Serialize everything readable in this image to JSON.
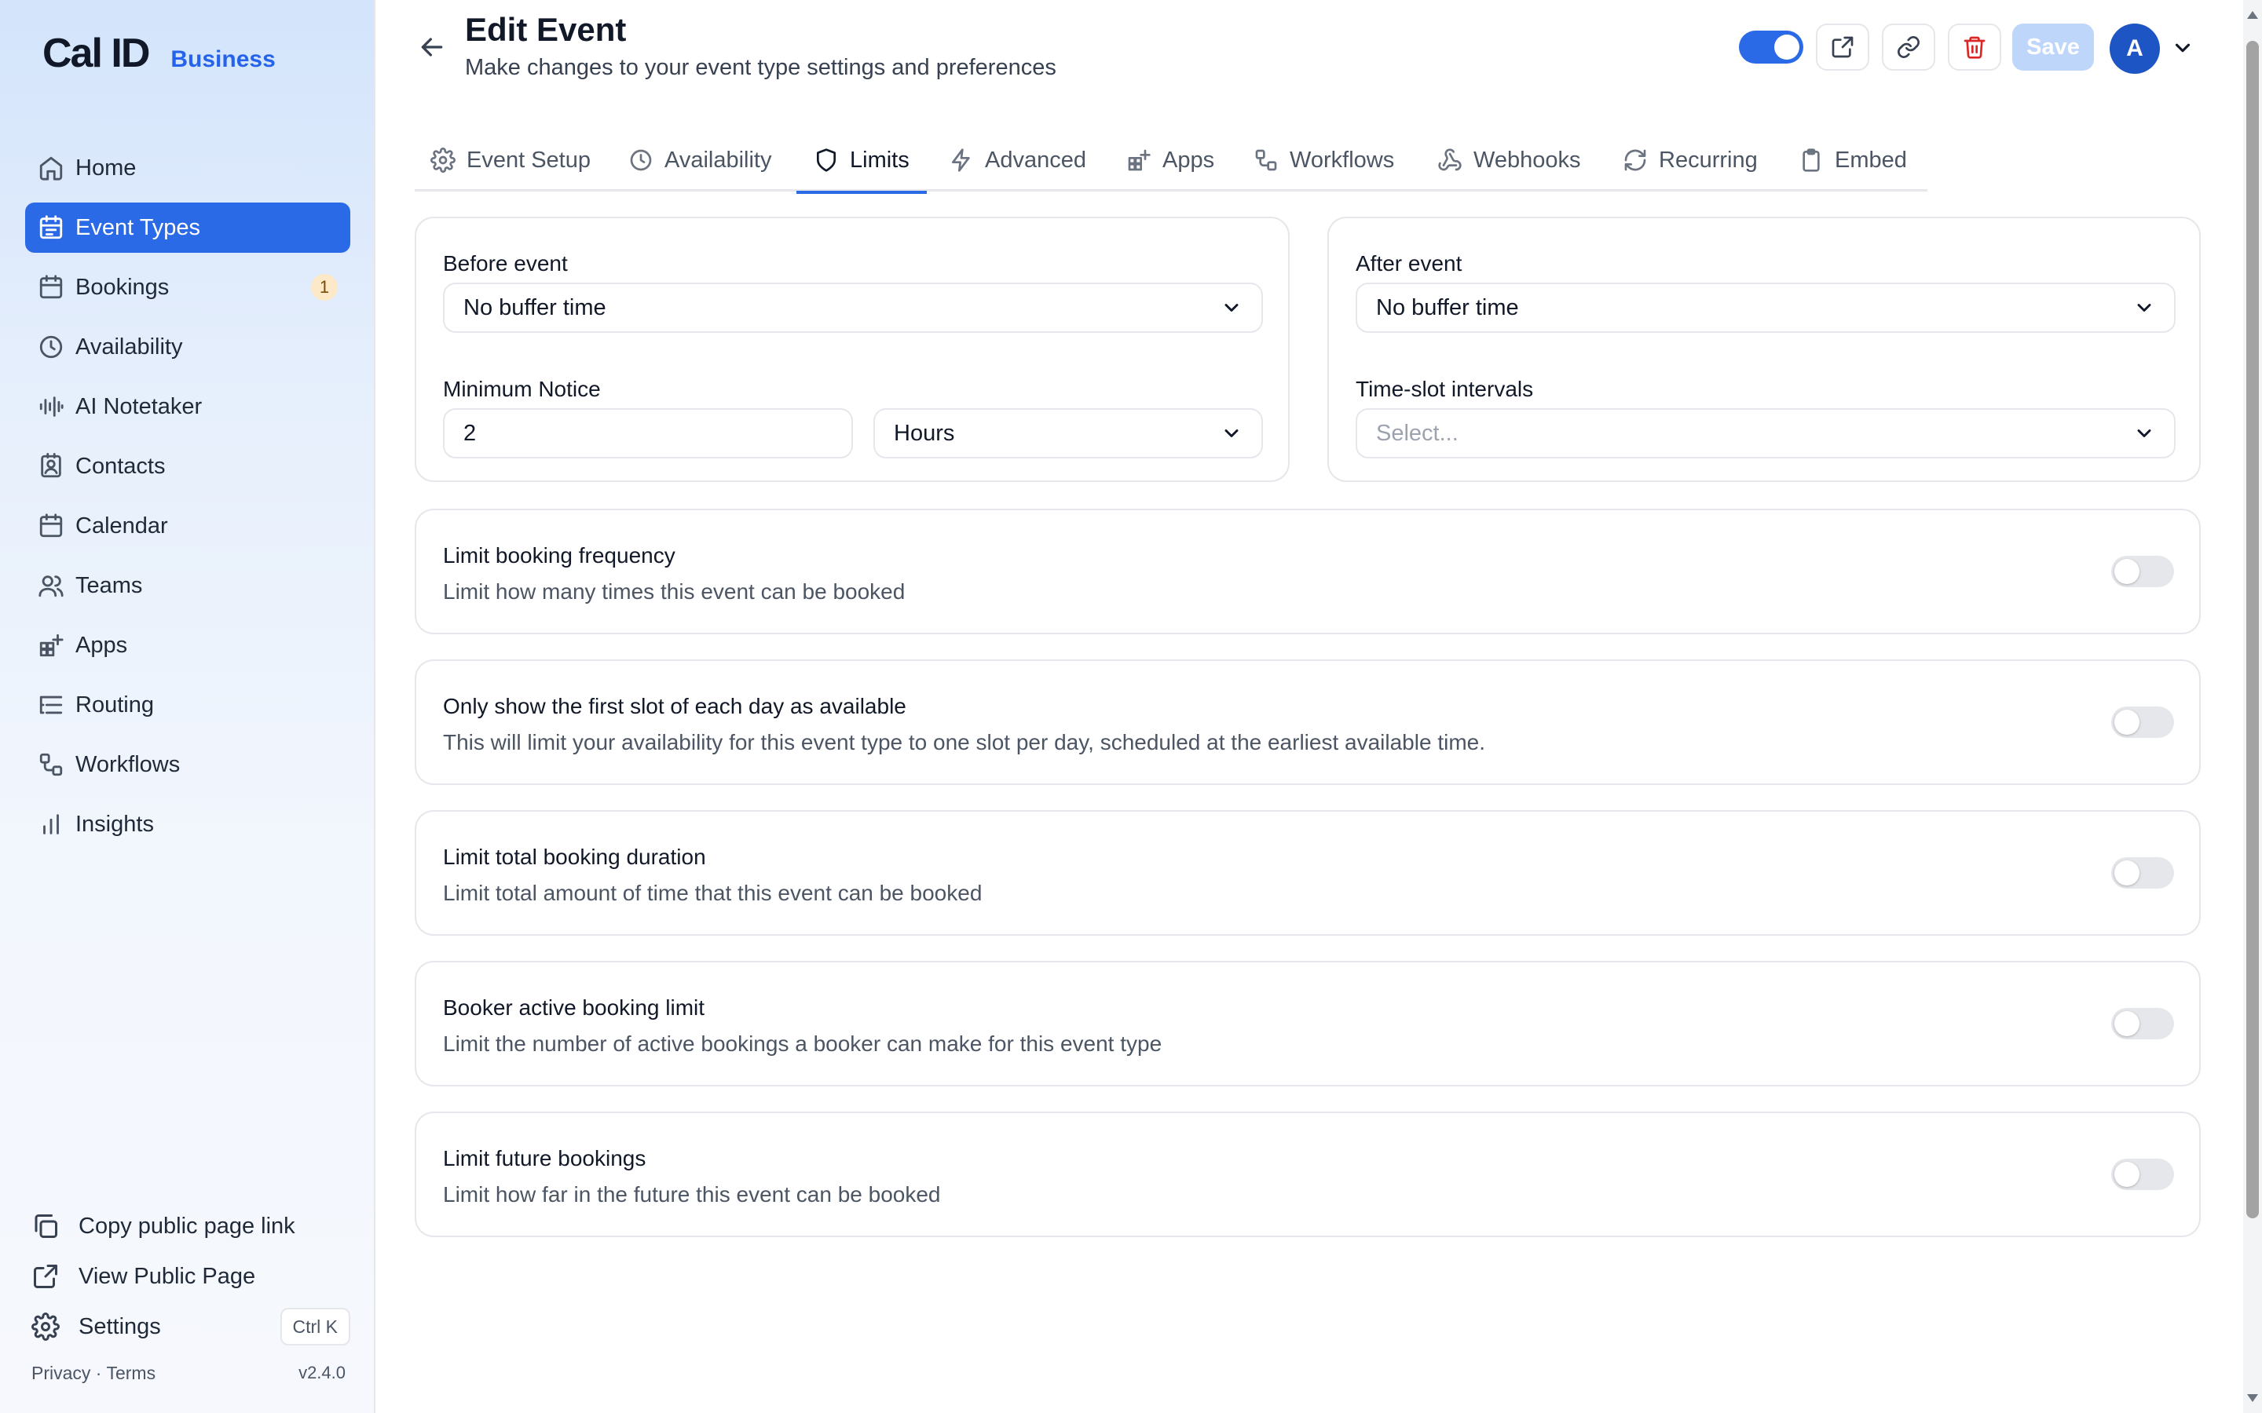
{
  "brand": {
    "name": "Cal ID",
    "tag": "Business"
  },
  "sidebar": {
    "items": [
      {
        "label": "Home",
        "icon": "home-icon"
      },
      {
        "label": "Event Types",
        "icon": "event-types-icon",
        "active": true
      },
      {
        "label": "Bookings",
        "icon": "calendar-icon",
        "badge": "1"
      },
      {
        "label": "Availability",
        "icon": "clock-icon"
      },
      {
        "label": "AI Notetaker",
        "icon": "audio-waveform-icon"
      },
      {
        "label": "Contacts",
        "icon": "contact-icon"
      },
      {
        "label": "Calendar",
        "icon": "calendar-icon"
      },
      {
        "label": "Teams",
        "icon": "users-icon"
      },
      {
        "label": "Apps",
        "icon": "grid-plus-icon"
      },
      {
        "label": "Routing",
        "icon": "list-tree-icon"
      },
      {
        "label": "Workflows",
        "icon": "workflow-icon"
      },
      {
        "label": "Insights",
        "icon": "bar-chart-icon"
      }
    ],
    "bottom": {
      "copy_link": "Copy public page link",
      "view_public": "View Public Page",
      "settings": "Settings",
      "shortcut": "Ctrl K"
    },
    "legal": {
      "privacy": "Privacy",
      "separator": "·",
      "terms": "Terms",
      "version": "v2.4.0"
    }
  },
  "header": {
    "title": "Edit Event",
    "subtitle": "Make changes to your event type settings and preferences",
    "save_label": "Save",
    "avatar_initial": "A",
    "event_enabled": true
  },
  "tabs": [
    {
      "label": "Event Setup",
      "icon": "gear-icon"
    },
    {
      "label": "Availability",
      "icon": "clock-icon"
    },
    {
      "label": "Limits",
      "icon": "shield-icon",
      "active": true
    },
    {
      "label": "Advanced",
      "icon": "lightning-icon"
    },
    {
      "label": "Apps",
      "icon": "grid-plus-icon"
    },
    {
      "label": "Workflows",
      "icon": "workflow-icon"
    },
    {
      "label": "Webhooks",
      "icon": "webhook-icon"
    },
    {
      "label": "Recurring",
      "icon": "refresh-icon"
    },
    {
      "label": "Embed",
      "icon": "clipboard-icon"
    }
  ],
  "limits": {
    "before_event": {
      "label": "Before event",
      "value": "No buffer time"
    },
    "after_event": {
      "label": "After event",
      "value": "No buffer time"
    },
    "minimum_notice": {
      "label": "Minimum Notice",
      "value": "2",
      "unit": "Hours"
    },
    "time_slot": {
      "label": "Time-slot intervals",
      "placeholder": "Select..."
    },
    "toggles": [
      {
        "title": "Limit booking frequency",
        "description": "Limit how many times this event can be booked",
        "enabled": false
      },
      {
        "title": "Only show the first slot of each day as available",
        "description": "This will limit your availability for this event type to one slot per day, scheduled at the earliest available time.",
        "enabled": false
      },
      {
        "title": "Limit total booking duration",
        "description": "Limit total amount of time that this event can be booked",
        "enabled": false
      },
      {
        "title": "Booker active booking limit",
        "description": "Limit the number of active bookings a booker can make for this event type",
        "enabled": false
      },
      {
        "title": "Limit future bookings",
        "description": "Limit how far in the future this event can be booked",
        "enabled": false
      }
    ]
  },
  "colors": {
    "accent": "#2b6ae6",
    "danger": "#dc2626",
    "badge_bg": "#fde8c8"
  }
}
